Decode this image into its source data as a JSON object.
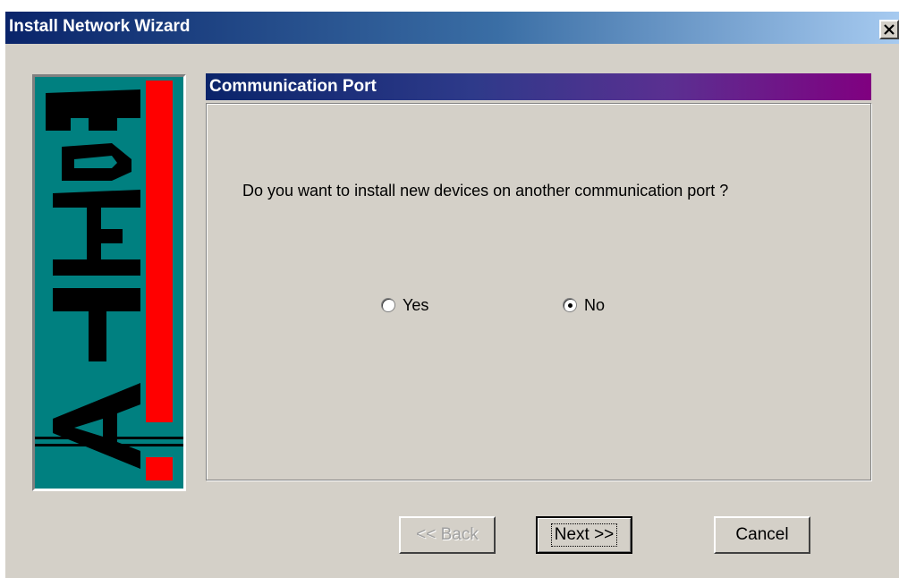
{
  "window": {
    "title": "Install Network Wizard",
    "close_symbol": "×"
  },
  "logo": {
    "text": "ATEQ",
    "colors": {
      "background": "#008080",
      "letters": "#000000",
      "bar": "#ff0000"
    }
  },
  "panel": {
    "header": "Communication Port",
    "question": "Do you want to install new devices on another communication port ?",
    "options": [
      {
        "label": "Yes",
        "selected": false
      },
      {
        "label": "No",
        "selected": true
      }
    ]
  },
  "buttons": {
    "back": "<< Back",
    "next": "Next >>",
    "cancel": "Cancel"
  },
  "colors": {
    "dialog_bg": "#d4d0c8",
    "title_start": "#0a246a",
    "title_end": "#a6caf0",
    "header_end": "#800080"
  }
}
